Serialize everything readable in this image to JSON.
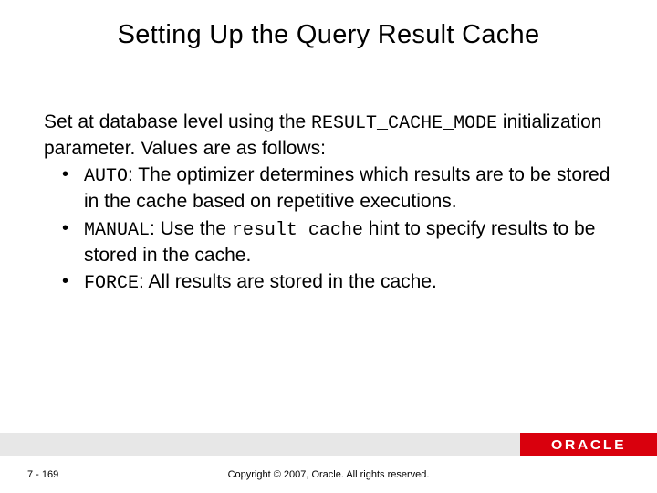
{
  "title": "Setting Up the Query Result Cache",
  "intro_pre": "Set at database level using the ",
  "intro_code": "RESULT_CACHE_MODE",
  "intro_post": " initialization parameter. Values are as follows:",
  "bullets": [
    {
      "code": "AUTO",
      "text": ": The optimizer determines which results are to be stored in the cache based on repetitive executions."
    },
    {
      "code": "MANUAL",
      "text_pre": ": Use the ",
      "text_code": "result_cache",
      "text_post": " hint to specify results to be stored in the cache."
    },
    {
      "code": "FORCE",
      "text": ": All results are stored in the cache."
    }
  ],
  "footer": {
    "page": "7 - 169",
    "copyright": "Copyright © 2007, Oracle. All rights reserved.",
    "logo": "ORACLE"
  }
}
